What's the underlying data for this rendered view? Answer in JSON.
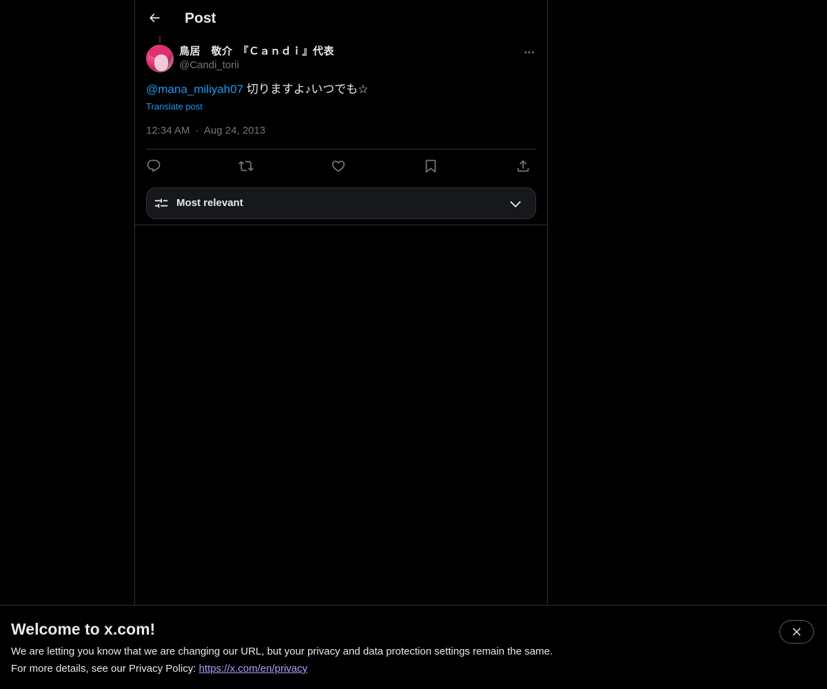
{
  "header": {
    "title": "Post"
  },
  "tweet": {
    "display_name": "鳥居　敬介　『Ｃａｎｄｉ』代表",
    "handle": "@Candi_torii",
    "mention": "@mana_miliyah07",
    "text": " 切りますよ♪いつでも☆",
    "translate_label": "Translate post",
    "time": "12:34 AM",
    "separator": "·",
    "date": "Aug 24, 2013"
  },
  "sort": {
    "label": "Most relevant"
  },
  "banner": {
    "title": "Welcome to x.com!",
    "line1": "We are letting you know that we are changing our URL, but your privacy and data protection settings remain the same.",
    "line2_prefix": "For more details, see our Privacy Policy: ",
    "link": "https://x.com/en/privacy"
  },
  "icons": {
    "back": "back-arrow-icon",
    "more": "more-icon",
    "reply": "reply-icon",
    "repost": "repost-icon",
    "like": "heart-icon",
    "bookmark": "bookmark-icon",
    "share": "share-icon",
    "sort": "sliders-icon",
    "chevron": "chevron-down-icon",
    "close": "close-icon"
  },
  "colors": {
    "background": "#000000",
    "text": "#e7e9ea",
    "secondary": "#71767b",
    "accent": "#1d9bf0",
    "link": "#a9a0ff",
    "border": "#2f3336"
  }
}
